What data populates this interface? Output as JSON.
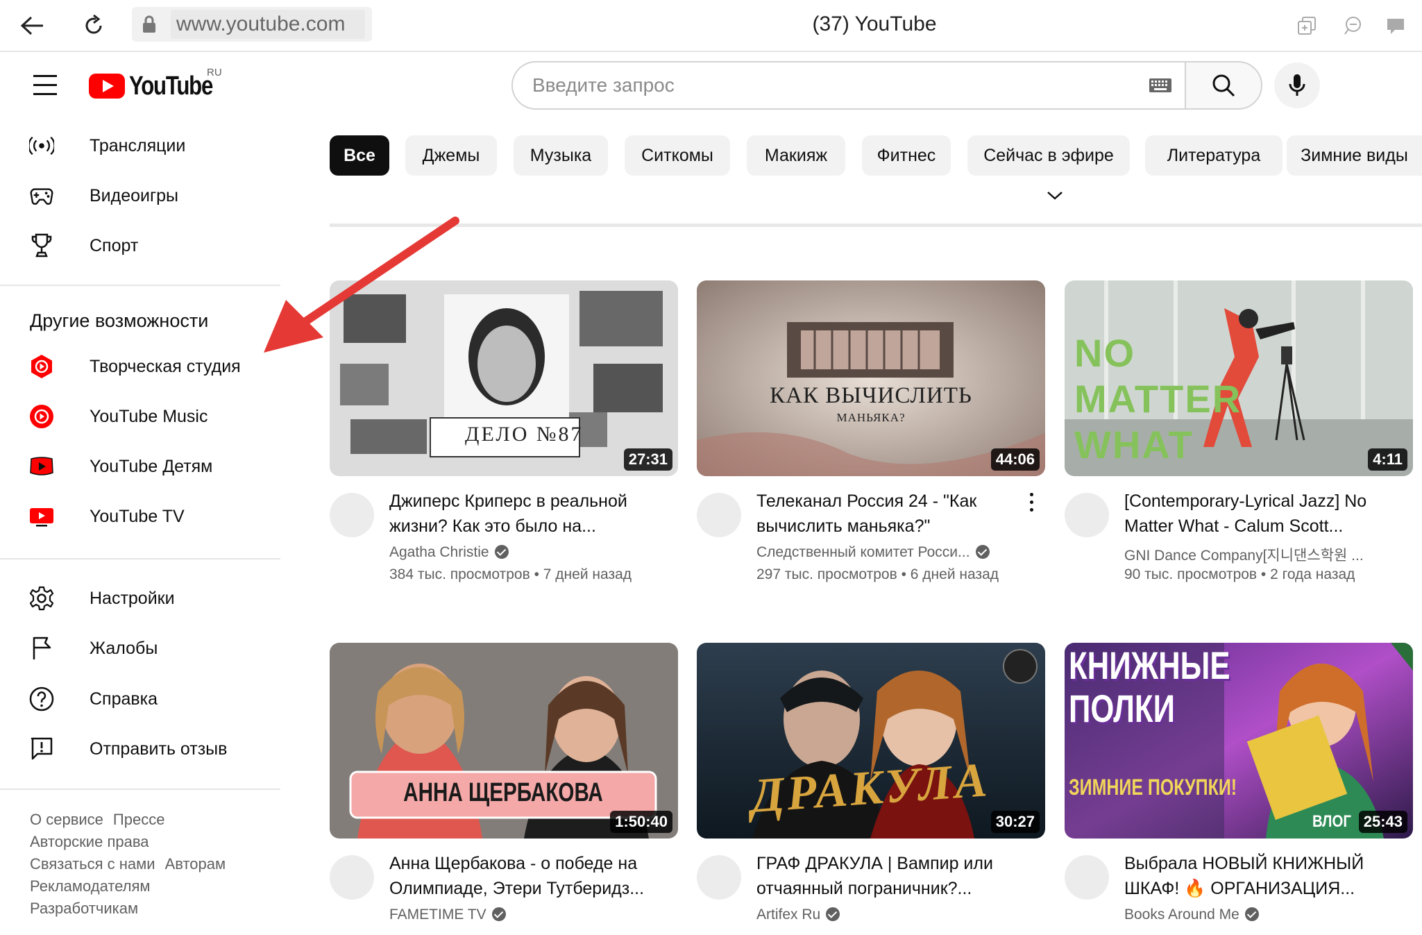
{
  "browser": {
    "url": "www.youtube.com",
    "tab_title": "(37) YouTube"
  },
  "header": {
    "logo_text": "YouTube",
    "region": "RU",
    "search_placeholder": "Введите запрос"
  },
  "sidebar": {
    "top_items": [
      {
        "label": "Трансляции",
        "icon": "live-icon"
      },
      {
        "label": "Видеоигры",
        "icon": "gamepad-icon"
      },
      {
        "label": "Спорт",
        "icon": "trophy-icon"
      }
    ],
    "more_heading": "Другие возможности",
    "more_items": [
      {
        "label": "Творческая студия",
        "icon": "studio-icon"
      },
      {
        "label": "YouTube Music",
        "icon": "music-icon"
      },
      {
        "label": "YouTube Детям",
        "icon": "kids-icon"
      },
      {
        "label": "YouTube TV",
        "icon": "tv-icon"
      }
    ],
    "settings_items": [
      {
        "label": "Настройки",
        "icon": "gear-icon"
      },
      {
        "label": "Жалобы",
        "icon": "flag-icon"
      },
      {
        "label": "Справка",
        "icon": "help-icon"
      },
      {
        "label": "Отправить отзыв",
        "icon": "feedback-icon"
      }
    ],
    "footer_links": [
      "О сервисе",
      "Прессе",
      "Авторские права",
      "Связаться с нами",
      "Авторам",
      "Рекламодателям",
      "Разработчикам"
    ]
  },
  "chips": [
    "Все",
    "Джемы",
    "Музыка",
    "Ситкомы",
    "Макияж",
    "Фитнес",
    "Сейчас в эфире",
    "Литература",
    "Зимние виды"
  ],
  "videos": [
    {
      "title": "Джиперс Криперс в реальной жизни? Как это было на...",
      "channel": "Agatha Christie",
      "meta": "384 тыс. просмотров • 7 дней назад",
      "duration": "27:31",
      "thumb_text": "ДЕЛО №87"
    },
    {
      "title": "Телеканал Россия 24 - \"Как вычислить маньяка?\"",
      "channel": "Следственный комитет Росси...",
      "meta": "297 тыс. просмотров • 6 дней назад",
      "duration": "44:06",
      "thumb_text": "КАК ВЫЧИСЛИТЬ",
      "thumb_sub": "МАНЬЯКА?"
    },
    {
      "title": "[Contemporary-Lyrical Jazz] No Matter What - Calum Scott...",
      "channel": "GNI Dance Company[지니댄스학원 ...",
      "meta": "90 тыс. просмотров • 2 года назад",
      "duration": "4:11",
      "thumb_text": "NO MATTER WHAT"
    },
    {
      "title": "Анна Щербакова - о победе на Олимпиаде, Этери Тутберидз...",
      "channel": "FAMETIME TV",
      "meta": "",
      "duration": "1:50:40",
      "thumb_text": "АННА ЩЕРБАКОВА"
    },
    {
      "title": "ГРАФ ДРАКУЛА | Вампир или отчаянный пограничник?...",
      "channel": "Artifex Ru",
      "meta": "",
      "duration": "30:27",
      "thumb_text": "ДРАКУЛА"
    },
    {
      "title": "Выбрала НОВЫЙ КНИЖНЫЙ ШКАФ! 🔥 ОРГАНИЗАЦИЯ...",
      "channel": "Books Around Me",
      "meta": "",
      "duration": "25:43",
      "thumb_text": "КНИЖНЫЕ ПОЛКИ",
      "thumb_sub": "ЗИМНИЕ ПОКУПКИ!",
      "thumb_badge": "ВЛОГ"
    }
  ],
  "colors": {
    "brand_red": "#ff0000",
    "arrow_red": "#e53935"
  }
}
